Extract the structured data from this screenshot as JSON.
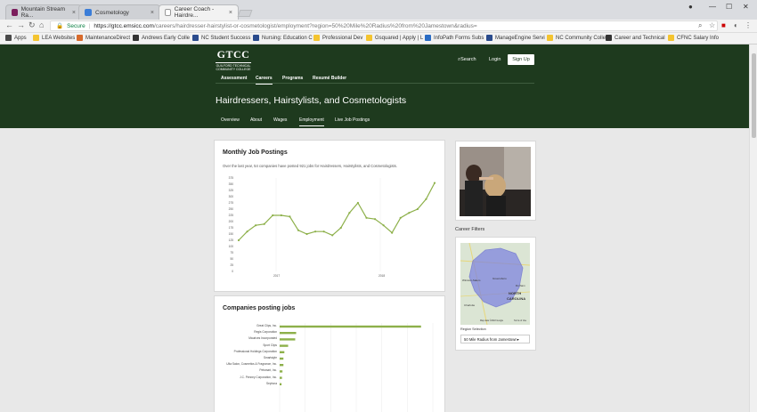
{
  "browser": {
    "tabs": [
      {
        "title": "Mountain Stream Ra..."
      },
      {
        "title": "Cosmetology"
      },
      {
        "title": "Career Coach - Hairdre..."
      }
    ],
    "secure_label": "Secure",
    "url_host": "https://gtcc.emsicc.com",
    "url_path": "/careers/hairdresser-hairstylist-or-cosmetologist/employment?region=50%20Mile%20Radius%20from%20Jamestown&radius=",
    "bookmarks": [
      "Apps",
      "LEA Websites",
      "MaintenanceDirect",
      "Andrews Early Colle",
      "NC Student Success",
      "Nursing: Education C",
      "Professional Dev",
      "Gsquared | Apply | L",
      "InfoPath Forms Subs",
      "ManageEngine Servi",
      "NC Community Colle",
      "Career and Technical",
      "CFNC Salary Info"
    ]
  },
  "header": {
    "logo_text": "GTCC",
    "logo_sub": "GUILFORD TECHNICAL COMMUNITY COLLEGE",
    "search_label": "Search",
    "login_label": "Login",
    "signup_label": "Sign Up",
    "nav": [
      "Assessment",
      "Careers",
      "Programs",
      "Resumé Builder"
    ],
    "page_title": "Hairdressers, Hairstylists, and Cosmetologists",
    "subnav": [
      "Overview",
      "About",
      "Wages",
      "Employment",
      "Live Job Postings"
    ]
  },
  "monthly": {
    "title": "Monthly Job Postings",
    "description": "Over the last year, 54 companies have posted 921 jobs for Hairdressers, Hairstylists, and Cosmetologists."
  },
  "companies_title": "Companies posting jobs",
  "sidebar": {
    "career_filters": "Career Filters",
    "region_label": "Region Selection",
    "region_value": "50 Mile Radius from Jamestown",
    "map_labels": [
      "Winston-Salem",
      "Greensboro",
      "Durham",
      "NORTH",
      "CAROLINA",
      "Charlotte",
      "Map data ©2018 Google",
      "Terms of Use"
    ]
  },
  "chart_data": [
    {
      "type": "line",
      "title": "Monthly Job Postings",
      "y_ticks": [
        "375",
        "350",
        "325",
        "300",
        "275",
        "250",
        "225",
        "200",
        "175",
        "150",
        "125",
        "100",
        "75",
        "50",
        "25",
        "0"
      ],
      "x_ticks": [
        "2017",
        "2018"
      ],
      "ylim": [
        0,
        375
      ],
      "x": [
        0,
        1,
        2,
        3,
        4,
        5,
        6,
        7,
        8,
        9,
        10,
        11,
        12,
        13,
        14,
        15,
        16,
        17,
        18,
        19,
        20,
        21,
        22,
        23
      ],
      "values": [
        125,
        160,
        185,
        190,
        225,
        225,
        220,
        165,
        150,
        160,
        160,
        145,
        175,
        235,
        275,
        215,
        210,
        185,
        155,
        215,
        235,
        250,
        290,
        355
      ],
      "color": "#8db04a"
    },
    {
      "type": "bar",
      "title": "Companies posting jobs",
      "categories": [
        "Great Clips, Inc.",
        "Regis Corporation",
        "Maurices Incorporated",
        "Sport Clips",
        "Professional Holdings Corporation",
        "Smartstyle",
        "Ulta Salon, Cosmetics & Fragrance, Inc.",
        "Petsmart, Inc.",
        "J.C. Penney Corporation, Inc.",
        "Sephora"
      ],
      "values": [
        300,
        35,
        33,
        18,
        10,
        8,
        8,
        6,
        5,
        4
      ],
      "xlim": [
        0,
        325
      ],
      "color": "#8db04a"
    }
  ]
}
